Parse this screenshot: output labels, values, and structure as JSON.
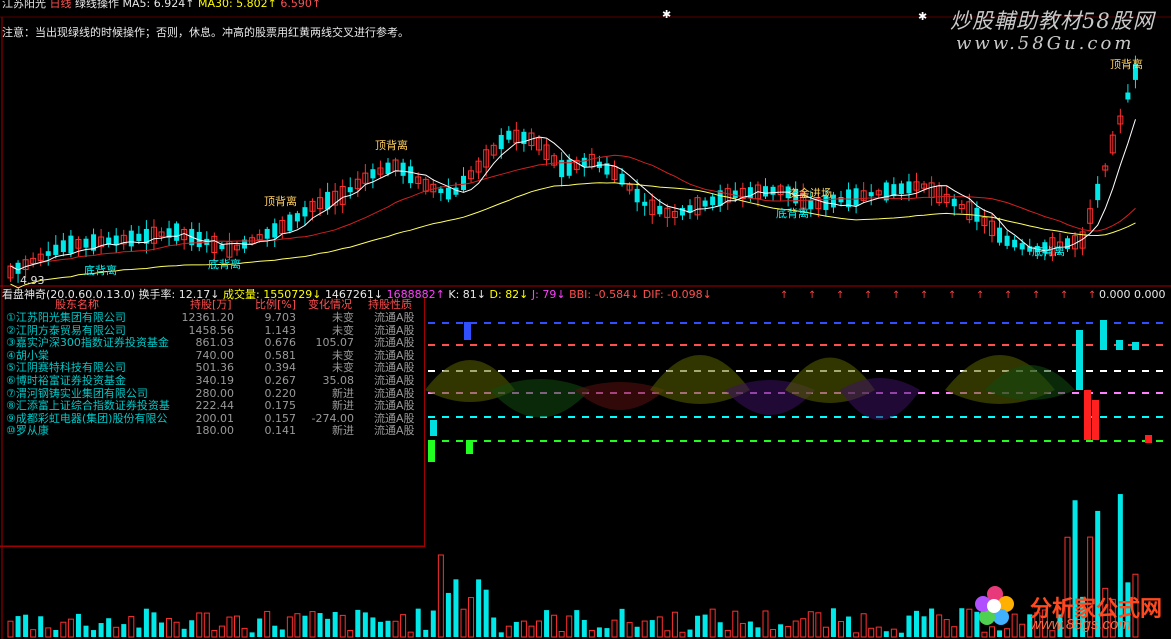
{
  "header": {
    "stock_name": "江苏阳光",
    "period": "日线",
    "indicator_name": "绿线操作",
    "ma5_label": "MA5:",
    "ma5_value": "6.924↑",
    "ma30_label": "MA30:",
    "ma30_value": "5.802↑",
    "extra_value": "6.590↑"
  },
  "note": "注意：当出现绿线的时候操作；否则，休息。冲高的股票用红黄两线交叉进行参考。",
  "watermarks": {
    "site_title": "炒股輔助教材58股网",
    "site_url": "www.58Gu.com",
    "logo_title": "分析家公式网",
    "logo_url": "www.88gs.com"
  },
  "price_chart": {
    "low_label": "4.93",
    "annotations": [
      "底背离",
      "底背离",
      "顶背离",
      "顶背离",
      "底背离",
      "资金进场",
      "底背离",
      "顶背离",
      "底背离"
    ],
    "colors": {
      "up": "#ff3030",
      "down": "#00e8e8",
      "ma5": "#ffffff",
      "ma30": "#ffff60",
      "ma_red": "#d02020"
    }
  },
  "status_bar": {
    "indicator": "看盘神奇(20.0.60.0.13.0)",
    "turnover_label": "换手率:",
    "turnover_value": "12.17↓",
    "volume_label": "成交量:",
    "volume_value": "1550729↓",
    "vol2": "1467261↓",
    "vol3": "1688882↑",
    "k": "K: 81↓",
    "d": "D: 82↓",
    "j": "J: 79↓",
    "bbi": "BBI: -0.584↓",
    "dif": "DIF: -0.098↓",
    "zero": "0.000",
    "zero2": "0.000"
  },
  "holders": {
    "headers": [
      "股东名称",
      "持股[万]",
      "比例[%]",
      "变化情况",
      "持股性质"
    ],
    "rows": [
      {
        "name": "①江苏阳光集团有限公司",
        "hold": "12361.20",
        "ratio": "9.703",
        "change": "未变",
        "type": "流通A股"
      },
      {
        "name": "②江阴方泰贸易有限公司",
        "hold": "1458.56",
        "ratio": "1.143",
        "change": "未变",
        "type": "流通A股"
      },
      {
        "name": "③嘉实沪深300指数证券投资基金",
        "hold": "861.03",
        "ratio": "0.676",
        "change": "105.07",
        "type": "流通A股"
      },
      {
        "name": "④胡小棠",
        "hold": "740.00",
        "ratio": "0.581",
        "change": "未变",
        "type": "流通A股"
      },
      {
        "name": "⑤江阴赛特科技有限公司",
        "hold": "501.36",
        "ratio": "0.394",
        "change": "未变",
        "type": "流通A股"
      },
      {
        "name": "⑥博时裕富证券投资基金",
        "hold": "340.19",
        "ratio": "0.267",
        "change": "35.08",
        "type": "流通A股"
      },
      {
        "name": "⑦渭河钢铸实业集团有限公司",
        "hold": "280.00",
        "ratio": "0.220",
        "change": "新进",
        "type": "流通A股"
      },
      {
        "name": "⑧汇添富上证综合指数证券投资基",
        "hold": "222.44",
        "ratio": "0.175",
        "change": "新进",
        "type": "流通A股"
      },
      {
        "name": "⑨成都彩虹电器(集团)股份有限公",
        "hold": "200.01",
        "ratio": "0.157",
        "change": "-274.00",
        "type": "流通A股"
      },
      {
        "name": "⑩罗从康",
        "hold": "180.00",
        "ratio": "0.141",
        "change": "新进",
        "type": "流通A股"
      }
    ]
  }
}
